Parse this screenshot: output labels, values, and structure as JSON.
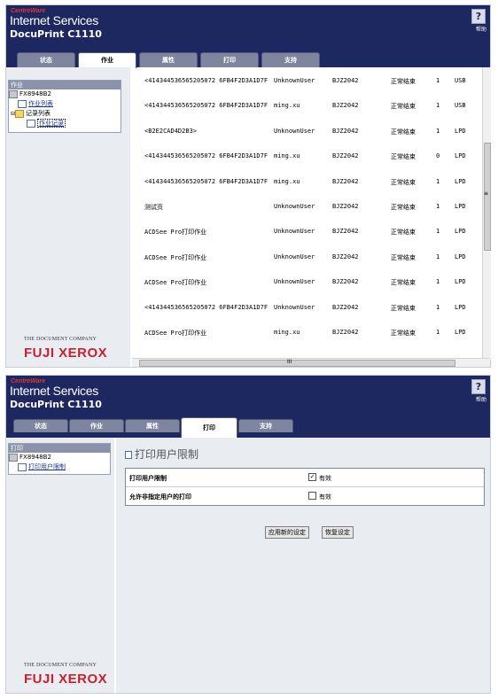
{
  "brand": {
    "top": "CentreWare",
    "main": "Internet Services",
    "model": "DocuPrint C1110"
  },
  "help": {
    "icon": "?",
    "label": "帮助"
  },
  "logo": {
    "sub": "THE DOCUMENT COMPANY",
    "main": "FUJI XEROX"
  },
  "tabs": [
    "状态",
    "作业",
    "属性",
    "打印",
    "支持"
  ],
  "panel1": {
    "active_tab": "作业",
    "tree": {
      "header": "作业",
      "device": "FX8948B2",
      "items": [
        "作业列表",
        "记录列表",
        "作业记录"
      ]
    },
    "jobs": [
      [
        "<414344536565205072 6FB4F2D3A1D7F",
        "UnknownUser",
        "BJZ2042",
        "正常结束",
        "1",
        "USB"
      ],
      [
        "<414344536565205072 6FB4F2D3A1D7F",
        "ming.xu",
        "BJZ2042",
        "正常结束",
        "1",
        "USB"
      ],
      [
        "<B2E2CAD4D2B3>",
        "UnknownUser",
        "BJZ2042",
        "正常结束",
        "1",
        "LPD"
      ],
      [
        "<414344536565205072 6FB4F2D3A1D7F",
        "ming.xu",
        "BJZ2042",
        "正常结束",
        "0",
        "LPD"
      ],
      [
        "<414344536565205072 6FB4F2D3A1D7F",
        "ming.xu",
        "BJZ2042",
        "正常结束",
        "1",
        "LPD"
      ],
      [
        "测试页",
        "UnknownUser",
        "BJZ2042",
        "正常结束",
        "1",
        "LPD"
      ],
      [
        "ACDSee Pro打印作业",
        "UnknownUser",
        "BJZ2042",
        "正常结束",
        "1",
        "LPD"
      ],
      [
        "ACDSee Pro打印作业",
        "UnknownUser",
        "BJZ2042",
        "正常结束",
        "1",
        "LPD"
      ],
      [
        "ACDSee Pro打印作业",
        "UnknownUser",
        "BJZ2042",
        "正常结束",
        "1",
        "LPD"
      ],
      [
        "<414344536565205072 6FB4F2D3A1D7F",
        "UnknownUser",
        "BJZ2042",
        "正常结束",
        "1",
        "LPD"
      ],
      [
        "ACDSee Pro打印作业",
        "ming.xu",
        "BJZ2042",
        "正常结束",
        "1",
        "LPD"
      ]
    ],
    "scroll_mid": "III",
    "scroll_right": "≡"
  },
  "panel2": {
    "active_tab": "打印",
    "tree": {
      "header": "打印",
      "device": "FX8948B2",
      "item": "打印用户限制"
    },
    "title": "打印用户限制",
    "settings": [
      {
        "label": "打印用户限制",
        "checked": true,
        "check_label": "有效"
      },
      {
        "label": "允许非指定用户的打印",
        "checked": false,
        "check_label": "有效"
      }
    ],
    "apply_label": "应用新的设定",
    "restore_label": "恢复设定"
  }
}
